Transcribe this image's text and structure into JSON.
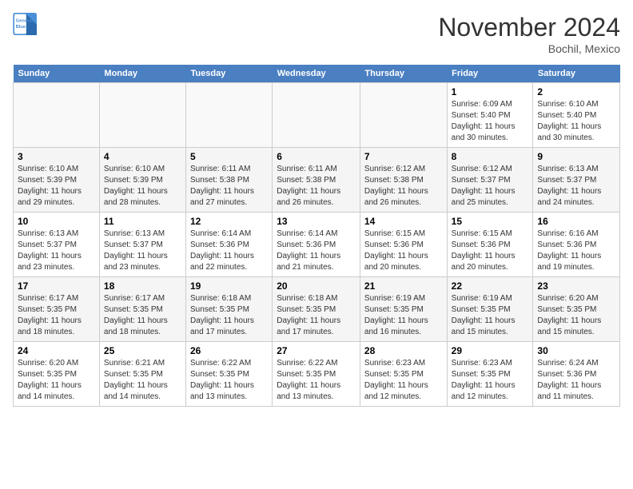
{
  "logo": {
    "line1": "General",
    "line2": "Blue"
  },
  "title": "November 2024",
  "subtitle": "Bochil, Mexico",
  "days_of_week": [
    "Sunday",
    "Monday",
    "Tuesday",
    "Wednesday",
    "Thursday",
    "Friday",
    "Saturday"
  ],
  "weeks": [
    [
      {
        "day": "",
        "info": ""
      },
      {
        "day": "",
        "info": ""
      },
      {
        "day": "",
        "info": ""
      },
      {
        "day": "",
        "info": ""
      },
      {
        "day": "",
        "info": ""
      },
      {
        "day": "1",
        "info": "Sunrise: 6:09 AM\nSunset: 5:40 PM\nDaylight: 11 hours and 30 minutes."
      },
      {
        "day": "2",
        "info": "Sunrise: 6:10 AM\nSunset: 5:40 PM\nDaylight: 11 hours and 30 minutes."
      }
    ],
    [
      {
        "day": "3",
        "info": "Sunrise: 6:10 AM\nSunset: 5:39 PM\nDaylight: 11 hours and 29 minutes."
      },
      {
        "day": "4",
        "info": "Sunrise: 6:10 AM\nSunset: 5:39 PM\nDaylight: 11 hours and 28 minutes."
      },
      {
        "day": "5",
        "info": "Sunrise: 6:11 AM\nSunset: 5:38 PM\nDaylight: 11 hours and 27 minutes."
      },
      {
        "day": "6",
        "info": "Sunrise: 6:11 AM\nSunset: 5:38 PM\nDaylight: 11 hours and 26 minutes."
      },
      {
        "day": "7",
        "info": "Sunrise: 6:12 AM\nSunset: 5:38 PM\nDaylight: 11 hours and 26 minutes."
      },
      {
        "day": "8",
        "info": "Sunrise: 6:12 AM\nSunset: 5:37 PM\nDaylight: 11 hours and 25 minutes."
      },
      {
        "day": "9",
        "info": "Sunrise: 6:13 AM\nSunset: 5:37 PM\nDaylight: 11 hours and 24 minutes."
      }
    ],
    [
      {
        "day": "10",
        "info": "Sunrise: 6:13 AM\nSunset: 5:37 PM\nDaylight: 11 hours and 23 minutes."
      },
      {
        "day": "11",
        "info": "Sunrise: 6:13 AM\nSunset: 5:37 PM\nDaylight: 11 hours and 23 minutes."
      },
      {
        "day": "12",
        "info": "Sunrise: 6:14 AM\nSunset: 5:36 PM\nDaylight: 11 hours and 22 minutes."
      },
      {
        "day": "13",
        "info": "Sunrise: 6:14 AM\nSunset: 5:36 PM\nDaylight: 11 hours and 21 minutes."
      },
      {
        "day": "14",
        "info": "Sunrise: 6:15 AM\nSunset: 5:36 PM\nDaylight: 11 hours and 20 minutes."
      },
      {
        "day": "15",
        "info": "Sunrise: 6:15 AM\nSunset: 5:36 PM\nDaylight: 11 hours and 20 minutes."
      },
      {
        "day": "16",
        "info": "Sunrise: 6:16 AM\nSunset: 5:36 PM\nDaylight: 11 hours and 19 minutes."
      }
    ],
    [
      {
        "day": "17",
        "info": "Sunrise: 6:17 AM\nSunset: 5:35 PM\nDaylight: 11 hours and 18 minutes."
      },
      {
        "day": "18",
        "info": "Sunrise: 6:17 AM\nSunset: 5:35 PM\nDaylight: 11 hours and 18 minutes."
      },
      {
        "day": "19",
        "info": "Sunrise: 6:18 AM\nSunset: 5:35 PM\nDaylight: 11 hours and 17 minutes."
      },
      {
        "day": "20",
        "info": "Sunrise: 6:18 AM\nSunset: 5:35 PM\nDaylight: 11 hours and 17 minutes."
      },
      {
        "day": "21",
        "info": "Sunrise: 6:19 AM\nSunset: 5:35 PM\nDaylight: 11 hours and 16 minutes."
      },
      {
        "day": "22",
        "info": "Sunrise: 6:19 AM\nSunset: 5:35 PM\nDaylight: 11 hours and 15 minutes."
      },
      {
        "day": "23",
        "info": "Sunrise: 6:20 AM\nSunset: 5:35 PM\nDaylight: 11 hours and 15 minutes."
      }
    ],
    [
      {
        "day": "24",
        "info": "Sunrise: 6:20 AM\nSunset: 5:35 PM\nDaylight: 11 hours and 14 minutes."
      },
      {
        "day": "25",
        "info": "Sunrise: 6:21 AM\nSunset: 5:35 PM\nDaylight: 11 hours and 14 minutes."
      },
      {
        "day": "26",
        "info": "Sunrise: 6:22 AM\nSunset: 5:35 PM\nDaylight: 11 hours and 13 minutes."
      },
      {
        "day": "27",
        "info": "Sunrise: 6:22 AM\nSunset: 5:35 PM\nDaylight: 11 hours and 13 minutes."
      },
      {
        "day": "28",
        "info": "Sunrise: 6:23 AM\nSunset: 5:35 PM\nDaylight: 11 hours and 12 minutes."
      },
      {
        "day": "29",
        "info": "Sunrise: 6:23 AM\nSunset: 5:35 PM\nDaylight: 11 hours and 12 minutes."
      },
      {
        "day": "30",
        "info": "Sunrise: 6:24 AM\nSunset: 5:36 PM\nDaylight: 11 hours and 11 minutes."
      }
    ]
  ]
}
